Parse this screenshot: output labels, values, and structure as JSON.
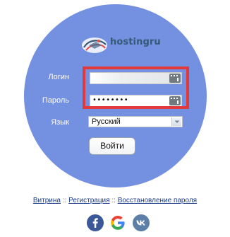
{
  "brand": {
    "name": "hostingru"
  },
  "form": {
    "login_label": "Логин",
    "password_label": "Пароль",
    "language_label": "Язык",
    "login_value": "",
    "password_masked": "••••••••",
    "language_selected": "Русский",
    "submit_label": "Войти"
  },
  "links": {
    "showcase": "Витрина",
    "register": "Регистрация",
    "restore": "Восстановление пароля",
    "separator": "::"
  },
  "social": [
    "facebook-icon",
    "google-icon",
    "vk-icon"
  ],
  "colors": {
    "circle": "#7490e0",
    "highlight": "#e23a3a",
    "link": "#1a3b8a"
  }
}
